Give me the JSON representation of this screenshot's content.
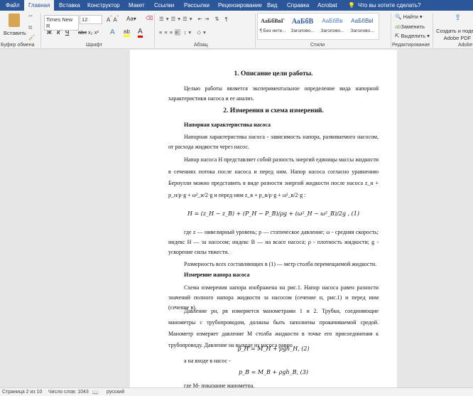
{
  "tabs": [
    "Файл",
    "Главная",
    "Вставка",
    "Конструктор",
    "Макет",
    "Ссылки",
    "Рассылки",
    "Рецензирование",
    "Вид",
    "Справка",
    "Acrobat",
    "Что вы хотите сделать?"
  ],
  "ribbon": {
    "paste": "Вставить",
    "clipboard": "Буфер обмена",
    "font_name": "Times New R",
    "font_size": "12",
    "font_group": "Шрифт",
    "paragraph_group": "Абзац",
    "styles": [
      {
        "sample": "АаБбВвГ",
        "name": "¶ Без инте..."
      },
      {
        "sample": "АаБбВ",
        "name": "Заголово..."
      },
      {
        "sample": "АаБбВв",
        "name": "Заголово..."
      },
      {
        "sample": "АаБбВвI",
        "name": "Заголово..."
      }
    ],
    "styles_group": "Стили",
    "find": "Найти",
    "replace": "Заменить",
    "select": "Выделить",
    "editing_group": "Редактирование",
    "adobe": "Создать и подел. Adobe PDF",
    "adobe_group": "Adobe",
    "bold": "Ж",
    "italic": "К",
    "underline": "Ч",
    "strike": "abc"
  },
  "doc": {
    "h1": "1. Описание цели работы.",
    "p1": "Целью работы является экспериментальное определение вида напорной характеристики насоса и ее анализ.",
    "h2": "2. Измерения и схема измерений.",
    "s1": "Напорная характеристика насоса",
    "p2": "Напорная характеристика насоса - зависимость напора, развиваемого насосом, от расхода жидкости через насос.",
    "p3": "Напор насоса Н представляет собой разность энергий единицы массы жидкости в сечениях потока после насоса и перед ним. Напор насоса согласно уравнению Бернулли можно представить в виде разности энергий жидкости после насоса z_н + p_н/ρ·g + ω²_н/2·g и перед ним z_в + p_в/ρ·g + ω²_в/2·g :",
    "eq1": "H = (z_H − z_B) + (P_H − P_B)/ρg + (ω²_H − ω²_B)/2g ,      (1)",
    "p4": "где z — нивелирный уровень; p — статическое давление; ω - средняя скорость; индекс Н — за насосом; индекс В — на всасе насоса; ρ - плотность жидкости; g - ускорение силы тяжести.",
    "p5": "Размерность всех составляющих в (1) — метр столба перемещаемой жидкости.",
    "s2": "Измерение напора насоса",
    "p6": "Схема измерения напора изображена на рис.1. Напор насоса равен разности значений полного напора жидкости за насосом (сечение н, рис.1) и перед ним (сечение в).",
    "p7": "Давление pн, pв измеряется манометрами 1 и 2. Трубки, соединяющие манометры с трубопроводом, должны быть заполнены прокачиваемой средой. Манометр измеряет давление M столба жидкости в точке его присоединения к трубопроводу. Давление на выходе из насоса равно",
    "eq2": "p_H = M_H + ρgh_H,      (2)",
    "p8": "а на входе в насос -",
    "eq3": "p_B = M_B + ρgh_B,      (3)",
    "p9": "где М- показание манометра."
  },
  "status": {
    "page": "Страница 2 из 10",
    "words": "Число слов: 1043",
    "lang": "русский"
  }
}
